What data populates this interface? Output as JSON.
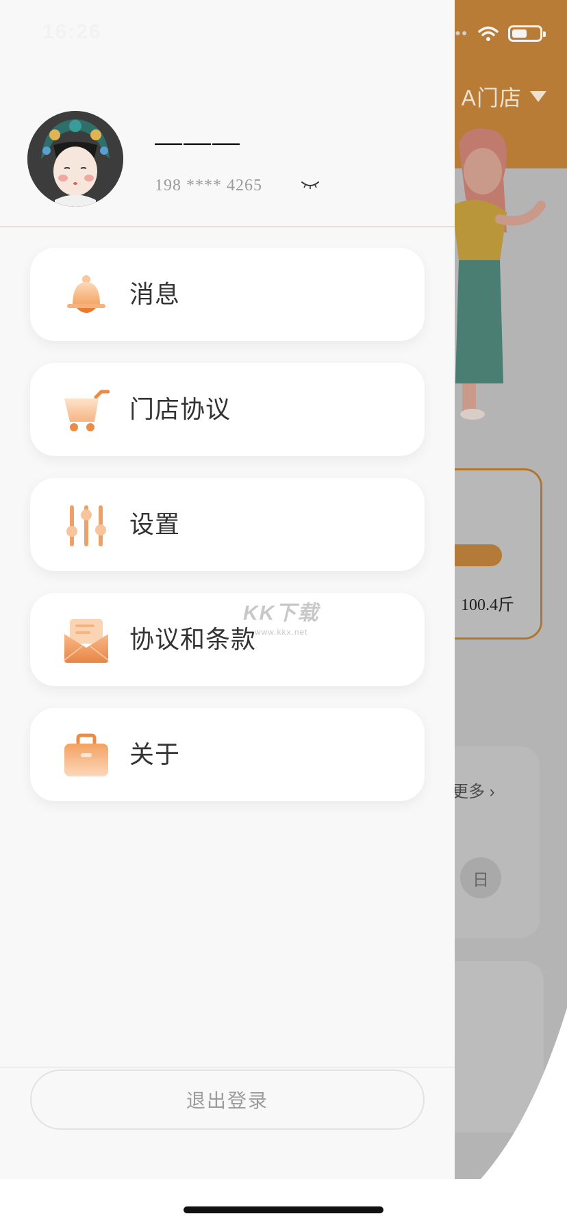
{
  "status_bar": {
    "time": "16:26"
  },
  "background_app": {
    "store_selector": "A门店",
    "weight_value": "100.4斤",
    "more_link": "更多 ›",
    "day_tab": "日"
  },
  "drawer": {
    "user": {
      "name": "———",
      "phone": "198 **** 4265"
    },
    "menu_items": [
      {
        "label": "消息",
        "icon": "bell-icon"
      },
      {
        "label": "门店协议",
        "icon": "cart-icon"
      },
      {
        "label": "设置",
        "icon": "sliders-icon"
      },
      {
        "label": "协议和条款",
        "icon": "envelope-icon"
      },
      {
        "label": "关于",
        "icon": "briefcase-icon"
      }
    ],
    "logout_label": "退出登录"
  },
  "watermark": {
    "main": "KK下载",
    "sub": "www.kkx.net"
  },
  "colors": {
    "accent": "#F2A45E",
    "accent_dark": "#E5823A",
    "header_dimmed": "#B87C36"
  }
}
